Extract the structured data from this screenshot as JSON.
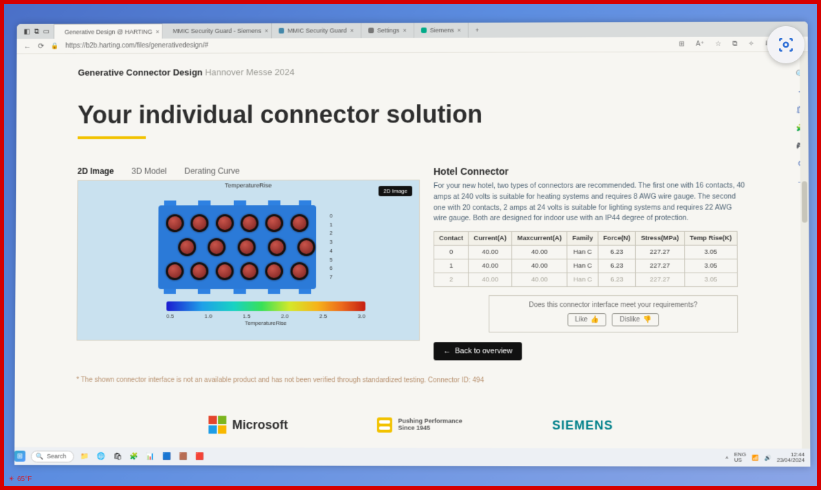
{
  "browser": {
    "tabs": [
      {
        "label": "Generative Design @ HARTING",
        "fav": "#f2c200",
        "active": true
      },
      {
        "label": "MMIC Security Guard - Siemens",
        "fav": "#0a8",
        "active": false
      },
      {
        "label": "MMIC Security Guard",
        "fav": "#48a",
        "active": false
      },
      {
        "label": "Settings",
        "fav": "#777",
        "active": false
      },
      {
        "label": "Siemens",
        "fav": "#0a8",
        "active": false
      }
    ],
    "url": "https://b2b.harting.com/files/generativedesign/#",
    "breadcrumb_main": "Generative Connector Design",
    "breadcrumb_sub": "Hannover Messe 2024"
  },
  "headline": "Your individual connector solution",
  "viz": {
    "tabs": [
      "2D Image",
      "3D Model",
      "Derating Curve"
    ],
    "active_tab": "2D Image",
    "plot_title": "TemperatureRise",
    "badge": "2D Image",
    "scale_ticks": [
      "0.5",
      "1.0",
      "1.5",
      "2.0",
      "2.5",
      "3.0"
    ],
    "scale_label": "TemperatureRise"
  },
  "result": {
    "title": "Hotel Connector",
    "description": "For your new hotel, two types of connectors are recommended. The first one with 16 contacts, 40 amps at 240 volts is suitable for heating systems and requires 8 AWG wire gauge. The second one with 20 contacts, 2 amps at 24 volts is suitable for lighting systems and requires 22 AWG wire gauge. Both are designed for indoor use with an IP44 degree of protection.",
    "columns": [
      "Contact",
      "Current(A)",
      "Maxcurrent(A)",
      "Family",
      "Force(N)",
      "Stress(MPa)",
      "Temp Rise(K)"
    ],
    "rows": [
      [
        "0",
        "40.00",
        "40.00",
        "Han C",
        "6.23",
        "227.27",
        "3.05"
      ],
      [
        "1",
        "40.00",
        "40.00",
        "Han C",
        "6.23",
        "227.27",
        "3.05"
      ],
      [
        "2",
        "40.00",
        "40.00",
        "Han C",
        "6.23",
        "227.27",
        "3.05"
      ]
    ],
    "feedback_prompt": "Does this connector interface meet your requirements?",
    "like_label": "Like",
    "dislike_label": "Dislike",
    "back_label": "Back to overview"
  },
  "disclaimer": "* The shown connector interface is not an available product and has not been verified through standardized testing. Connector ID: 494",
  "logos": {
    "microsoft": "Microsoft",
    "harting_line1": "Pushing Performance",
    "harting_line2": "Since 1945",
    "siemens": "SIEMENS"
  },
  "taskbar": {
    "search_placeholder": "Search",
    "lang": "ENG\nUS",
    "time": "12:44",
    "date": "23/04/2024",
    "weather": "65°F"
  }
}
